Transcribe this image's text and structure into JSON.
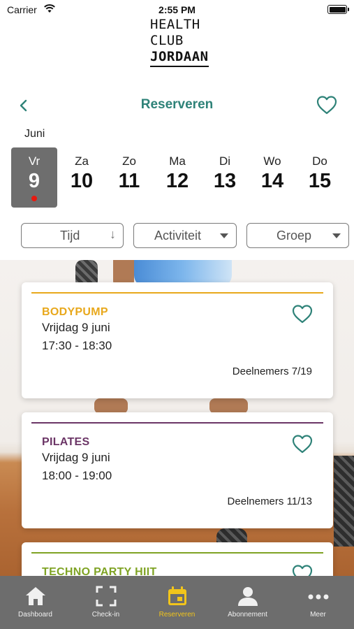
{
  "status_bar": {
    "carrier": "Carrier",
    "time": "2:55 PM",
    "battery_level": 1.0
  },
  "logo": {
    "line1": "HEALTH",
    "line2": "CLUB",
    "line3": "JORDAAN"
  },
  "header": {
    "title": "Reserveren"
  },
  "calendar": {
    "month": "Juni",
    "days": [
      {
        "name": "Vr",
        "date": "9"
      },
      {
        "name": "Za",
        "date": "10"
      },
      {
        "name": "Zo",
        "date": "11"
      },
      {
        "name": "Ma",
        "date": "12"
      },
      {
        "name": "Di",
        "date": "13"
      },
      {
        "name": "Wo",
        "date": "14"
      },
      {
        "name": "Do",
        "date": "15"
      }
    ],
    "selected_index": 0
  },
  "filters": {
    "time": "Tijd",
    "activity": "Activiteit",
    "group": "Groep"
  },
  "classes": [
    {
      "name": "BODYPUMP",
      "date": "Vrijdag 9 juni",
      "time": "17:30 - 18:30",
      "participants": "Deelnemers 7/19",
      "color": "#e8a81c"
    },
    {
      "name": "PILATES",
      "date": "Vrijdag 9 juni",
      "time": "18:00 - 19:00",
      "participants": "Deelnemers 11/13",
      "color": "#6b3566"
    },
    {
      "name": "TECHNO PARTY HIIT",
      "color": "#7fa324"
    }
  ],
  "colors": {
    "accent": "#2e8278",
    "selected_day_bg": "#6e6e6e",
    "tab_bar_bg": "#6d6d6d",
    "active_tab": "#f2c51b"
  },
  "tabbar": {
    "items": [
      {
        "label": "Dashboard",
        "icon": "home-icon"
      },
      {
        "label": "Check-in",
        "icon": "scan-icon"
      },
      {
        "label": "Reserveren",
        "icon": "calendar-icon"
      },
      {
        "label": "Abonnement",
        "icon": "person-icon"
      },
      {
        "label": "Meer",
        "icon": "more-icon"
      }
    ],
    "active_index": 2
  }
}
